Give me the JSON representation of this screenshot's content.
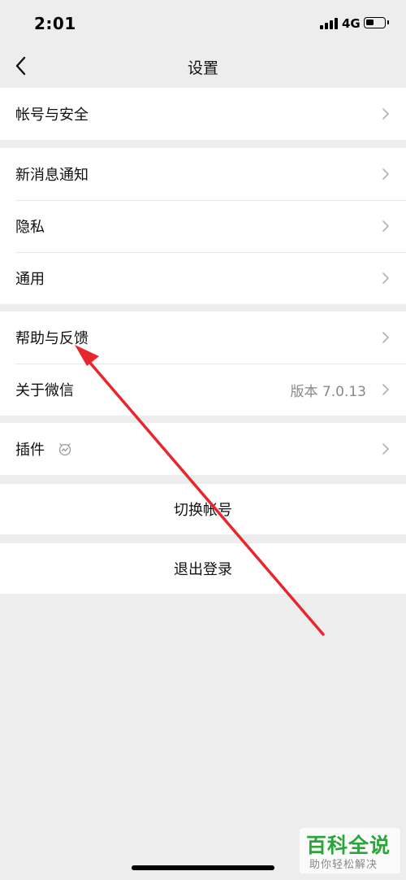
{
  "status_bar": {
    "time": "2:01",
    "network": "4G",
    "battery_level": 0.45
  },
  "navbar": {
    "title": "设置",
    "back_icon": "chevron-left-icon"
  },
  "groups": [
    {
      "items": [
        {
          "label": "帐号与安全"
        }
      ]
    },
    {
      "items": [
        {
          "label": "新消息通知"
        },
        {
          "label": "隐私"
        },
        {
          "label": "通用"
        }
      ]
    },
    {
      "items": [
        {
          "label": "帮助与反馈"
        },
        {
          "label": "关于微信",
          "value": "版本 7.0.13"
        }
      ]
    },
    {
      "items": [
        {
          "label": "插件",
          "icon": "plugin-icon"
        }
      ]
    }
  ],
  "actions": {
    "switch_account": "切换帐号",
    "logout": "退出登录"
  },
  "watermark": {
    "title": "百科全说",
    "subtitle": "助你轻松解决",
    "color": "#2aa53a"
  },
  "annotation": {
    "color": "#e8262d"
  }
}
